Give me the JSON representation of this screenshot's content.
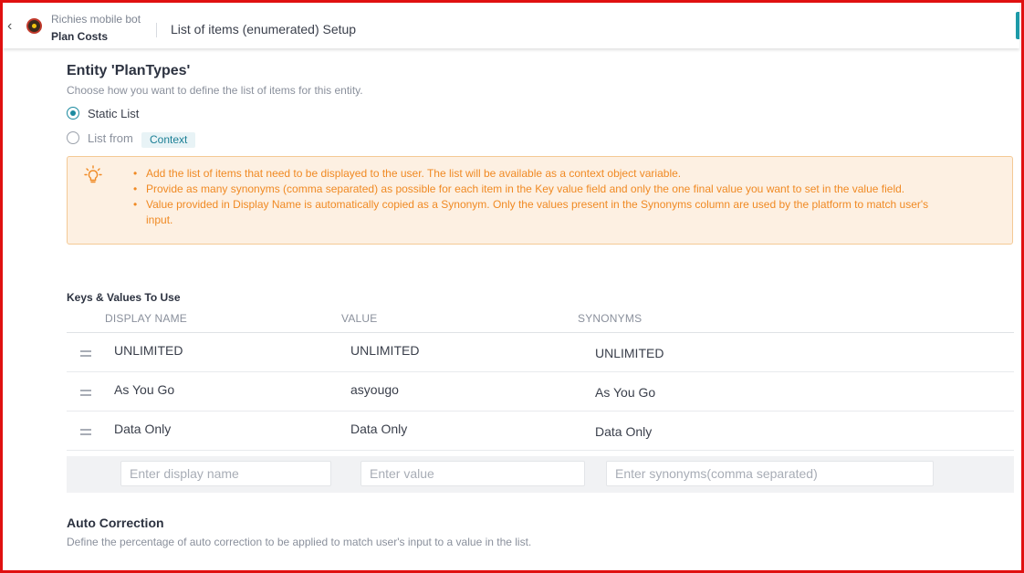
{
  "header": {
    "bot_name": "Richies mobile bot",
    "dialog_name": "Plan Costs",
    "setup_title": "List of items (enumerated) Setup"
  },
  "entity": {
    "title": "Entity 'PlanTypes'",
    "subtitle": "Choose how you want to define the list of items for this entity.",
    "options": {
      "static_label": "Static List",
      "static_selected": true,
      "list_from_label": "List from",
      "context_tag": "Context"
    }
  },
  "info": {
    "bullets": [
      "Add the list of items that need to be displayed to the user. The list will be available as a context object variable.",
      "Provide as many synonyms (comma separated) as possible for each item in the Key value field and only the one final value you want to set in the value field.",
      "Value provided in Display Name is automatically copied as a Synonym. Only the values present in the Synonyms column are used by the platform to match user's input."
    ]
  },
  "keys_values": {
    "title": "Keys & Values To Use",
    "columns": [
      "DISPLAY NAME",
      "VALUE",
      "SYNONYMS"
    ],
    "rows": [
      {
        "display": "UNLIMITED",
        "value": "UNLIMITED",
        "synonyms": "UNLIMITED"
      },
      {
        "display": "As You Go",
        "value": "asyougo",
        "synonyms": "As You Go"
      },
      {
        "display": "Data Only",
        "value": "Data Only",
        "synonyms": "Data Only"
      }
    ],
    "add_row": {
      "display_placeholder": "Enter display name",
      "value_placeholder": "Enter value",
      "synonyms_placeholder": "Enter synonyms(comma separated)"
    }
  },
  "auto_correction": {
    "title": "Auto Correction",
    "subtitle": "Define the percentage of auto correction to be applied to match user's input to a value in the list."
  },
  "colors": {
    "accent": "#1b8aa0",
    "warning_text": "#f08a24",
    "warning_bg": "#fdf0e2",
    "frame": "#e01010"
  },
  "icons": {
    "back": "chevron-left-icon",
    "bulb": "lightbulb-icon",
    "drag": "drag-handle-icon"
  }
}
